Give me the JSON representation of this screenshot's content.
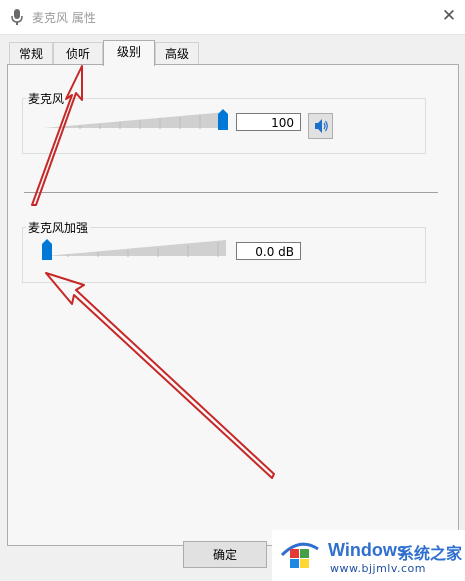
{
  "window": {
    "title": "麦克风 属性",
    "close_glyph": "✕"
  },
  "tabs": [
    {
      "label": "常规",
      "active": false
    },
    {
      "label": "侦听",
      "active": false
    },
    {
      "label": "级别",
      "active": true
    },
    {
      "label": "高级",
      "active": false
    }
  ],
  "levels": {
    "microphone": {
      "label": "麦克风",
      "value": "100",
      "level": 1.0
    },
    "boost": {
      "label": "麦克风加强",
      "value": "0.0 dB",
      "level": 0.0
    }
  },
  "buttons": {
    "ok_label": "确定"
  },
  "watermark": {
    "brand": "Windows",
    "site_cn": "系统之家",
    "url": "www.bjjmlv.com"
  },
  "colors": {
    "accent": "#0078d7",
    "annotation_arrow": "#c62828"
  }
}
